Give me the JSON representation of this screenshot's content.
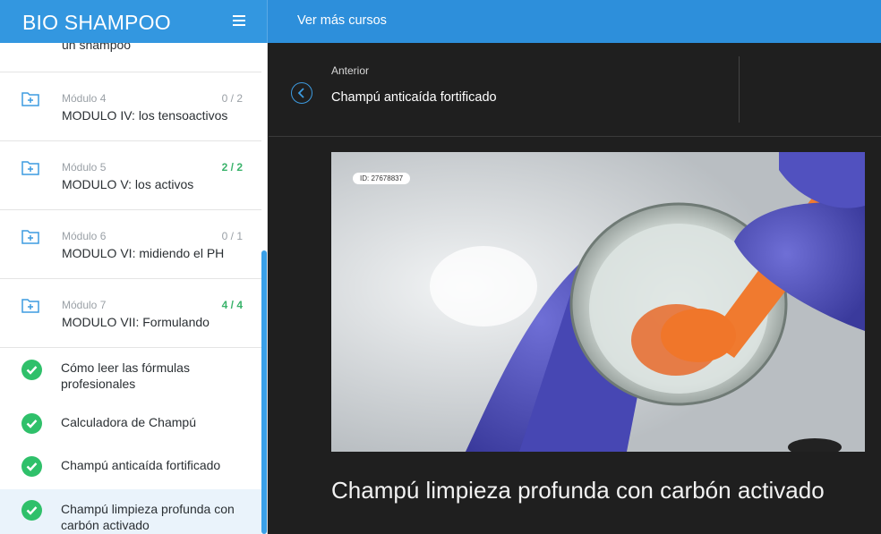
{
  "header": {
    "brand": "BIO SHAMPOO",
    "more_courses": "Ver más cursos"
  },
  "sidebar": {
    "partial_item": "un shampoo",
    "modules": [
      {
        "label": "Módulo 4",
        "count": "0 / 2",
        "title": "MODULO IV: los tensoactivos",
        "complete": false
      },
      {
        "label": "Módulo 5",
        "count": "2 / 2",
        "title": "MODULO V: los activos",
        "complete": true
      },
      {
        "label": "Módulo 6",
        "count": "0 / 1",
        "title": "MODULO VI: midiendo el PH",
        "complete": false
      },
      {
        "label": "Módulo 7",
        "count": "4 / 4",
        "title": "MODULO VII: Formulando",
        "complete": true
      }
    ],
    "lessons": [
      {
        "title": "Cómo leer las fórmulas profesionales"
      },
      {
        "title": "Calculadora de Champú"
      },
      {
        "title": "Champú anticaída fortificado"
      },
      {
        "title": "Champú limpieza profunda con carbón activado"
      }
    ]
  },
  "nav": {
    "prev_label": "Anterior",
    "prev_title": "Champú anticaída fortificado"
  },
  "video": {
    "id_badge": "ID: 27678837"
  },
  "lesson_title": "Champú limpieza profunda con carbón activado",
  "colors": {
    "brand_blue": "#2d8fdb",
    "success_green": "#2fc06a",
    "dark_bg": "#1f1f1f"
  }
}
